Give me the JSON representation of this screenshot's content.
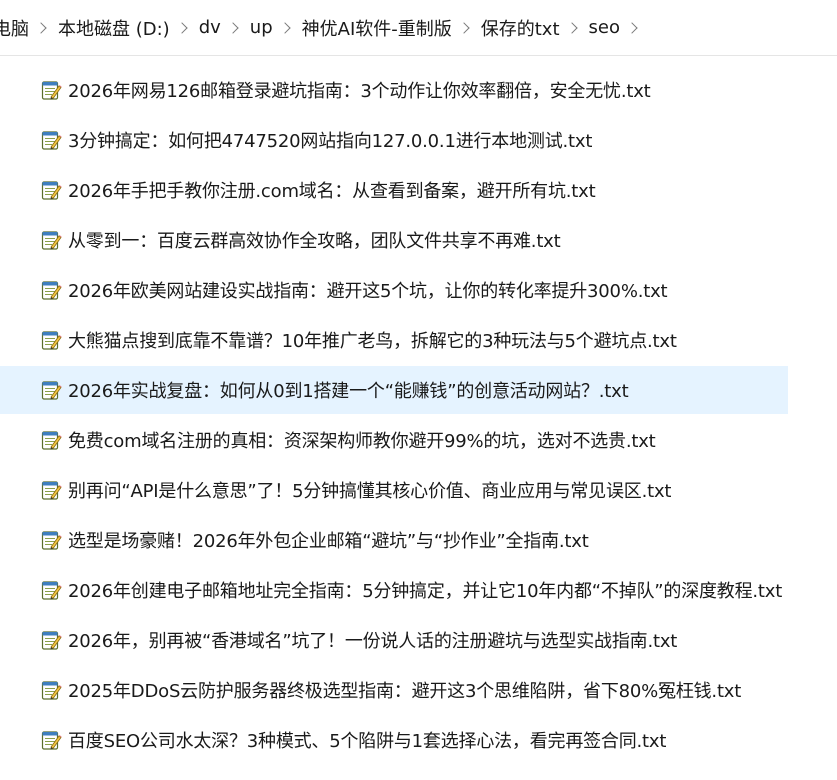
{
  "breadcrumb": {
    "items": [
      "电脑",
      "本地磁盘 (D:)",
      "dv",
      "up",
      "神优AI软件-重制版",
      "保存的txt",
      "seo"
    ]
  },
  "files": [
    {
      "name": "2026年网易126邮箱登录避坑指南：3个动作让你效率翻倍，安全无忧.txt",
      "selected": false
    },
    {
      "name": "3分钟搞定：如何把4747520网站指向127.0.0.1进行本地测试.txt",
      "selected": false
    },
    {
      "name": "2026年手把手教你注册.com域名：从查看到备案，避开所有坑.txt",
      "selected": false
    },
    {
      "name": "从零到一：百度云群高效协作全攻略，团队文件共享不再难.txt",
      "selected": false
    },
    {
      "name": "2026年欧美网站建设实战指南：避开这5个坑，让你的转化率提升300%.txt",
      "selected": false
    },
    {
      "name": "大熊猫点搜到底靠不靠谱？10年推广老鸟，拆解它的3种玩法与5个避坑点.txt",
      "selected": false
    },
    {
      "name": "2026年实战复盘：如何从0到1搭建一个“能赚钱”的创意活动网站？.txt",
      "selected": true
    },
    {
      "name": "免费com域名注册的真相：资深架构师教你避开99%的坑，选对不选贵.txt",
      "selected": false
    },
    {
      "name": "别再问“API是什么意思”了！5分钟搞懂其核心价值、商业应用与常见误区.txt",
      "selected": false
    },
    {
      "name": "选型是场豪赌！2026年外包企业邮箱“避坑”与“抄作业”全指南.txt",
      "selected": false
    },
    {
      "name": "2026年创建电子邮箱地址完全指南：5分钟搞定，并让它10年内都“不掉队”的深度教程.txt",
      "selected": false
    },
    {
      "name": "2026年，别再被“香港域名”坑了！一份说人话的注册避坑与选型实战指南.txt",
      "selected": false
    },
    {
      "name": "2025年DDoS云防护服务器终极选型指南：避开这3个思维陷阱，省下80%冤枉钱.txt",
      "selected": false
    },
    {
      "name": "百度SEO公司水太深？3种模式、5个陷阱与1套选择心法，看完再签合同.txt",
      "selected": false
    }
  ],
  "icon": "notepad-text-file-icon",
  "colors": {
    "selection": "#e5f3ff",
    "text": "#1a1a1a"
  }
}
